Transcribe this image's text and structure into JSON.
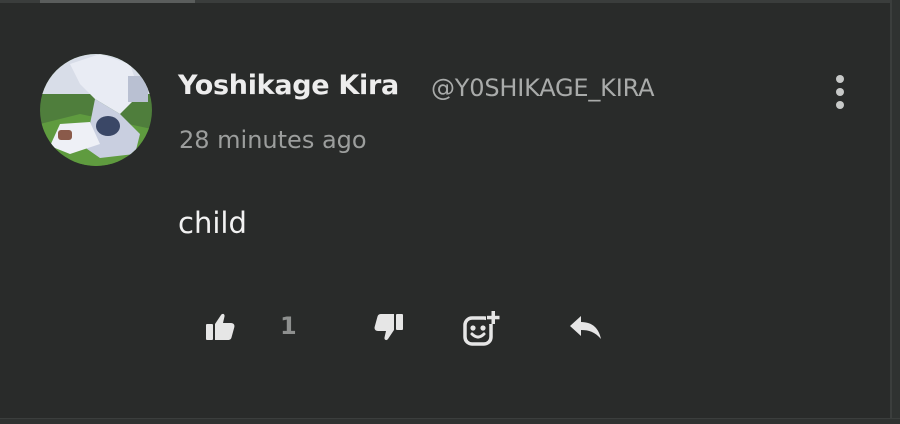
{
  "comment": {
    "author": {
      "display_name": "Yoshikage Kira",
      "handle": "@Y0SHIKAGE_KIRA",
      "avatar_icon": "user-avatar-image"
    },
    "timestamp": "28 minutes ago",
    "body": "child",
    "actions": {
      "like_count": "1",
      "like_icon": "thumbs-up-icon",
      "dislike_icon": "thumbs-down-icon",
      "react_icon": "add-reaction-icon",
      "reply_icon": "reply-icon",
      "more_icon": "more-vertical-icon"
    }
  },
  "colors": {
    "background": "#292b2a",
    "name_text": "#ededed",
    "secondary_text": "#9c9e9d",
    "icon": "#e6e6e6"
  }
}
